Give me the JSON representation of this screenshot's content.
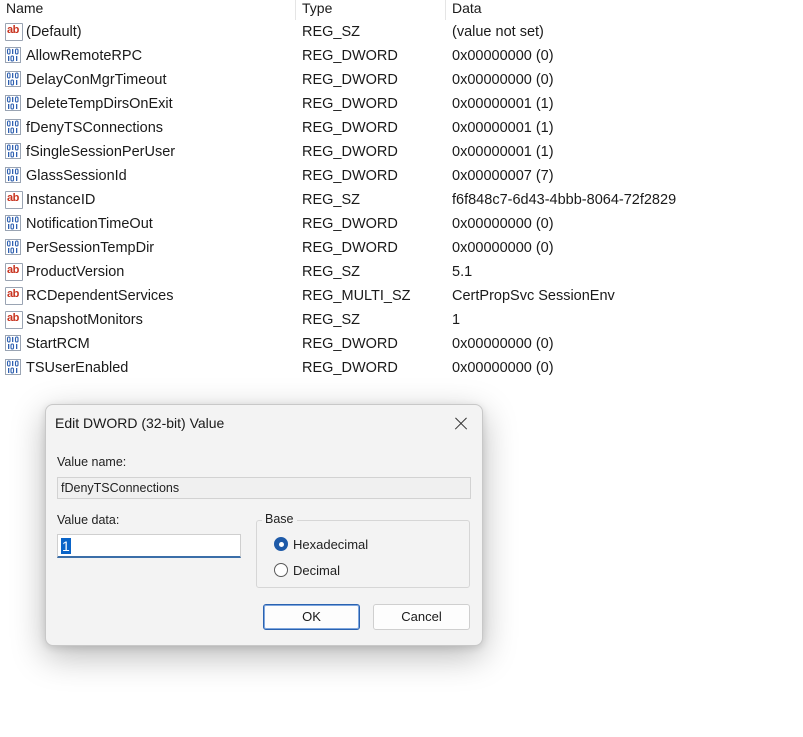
{
  "columns": {
    "name": "Name",
    "type": "Type",
    "data": "Data"
  },
  "rows": [
    {
      "icon": "string-value-icon",
      "name": "(Default)",
      "type": "REG_SZ",
      "data": "(value not set)"
    },
    {
      "icon": "binary-value-icon",
      "name": "AllowRemoteRPC",
      "type": "REG_DWORD",
      "data": "0x00000000 (0)"
    },
    {
      "icon": "binary-value-icon",
      "name": "DelayConMgrTimeout",
      "type": "REG_DWORD",
      "data": "0x00000000 (0)"
    },
    {
      "icon": "binary-value-icon",
      "name": "DeleteTempDirsOnExit",
      "type": "REG_DWORD",
      "data": "0x00000001 (1)"
    },
    {
      "icon": "binary-value-icon",
      "name": "fDenyTSConnections",
      "type": "REG_DWORD",
      "data": "0x00000001 (1)"
    },
    {
      "icon": "binary-value-icon",
      "name": "fSingleSessionPerUser",
      "type": "REG_DWORD",
      "data": "0x00000001 (1)"
    },
    {
      "icon": "binary-value-icon",
      "name": "GlassSessionId",
      "type": "REG_DWORD",
      "data": "0x00000007 (7)"
    },
    {
      "icon": "string-value-icon",
      "name": "InstanceID",
      "type": "REG_SZ",
      "data": "f6f848c7-6d43-4bbb-8064-72f2829"
    },
    {
      "icon": "binary-value-icon",
      "name": "NotificationTimeOut",
      "type": "REG_DWORD",
      "data": "0x00000000 (0)"
    },
    {
      "icon": "binary-value-icon",
      "name": "PerSessionTempDir",
      "type": "REG_DWORD",
      "data": "0x00000000 (0)"
    },
    {
      "icon": "string-value-icon",
      "name": "ProductVersion",
      "type": "REG_SZ",
      "data": "5.1"
    },
    {
      "icon": "string-value-icon",
      "name": "RCDependentServices",
      "type": "REG_MULTI_SZ",
      "data": "CertPropSvc SessionEnv"
    },
    {
      "icon": "string-value-icon",
      "name": "SnapshotMonitors",
      "type": "REG_SZ",
      "data": "1"
    },
    {
      "icon": "binary-value-icon",
      "name": "StartRCM",
      "type": "REG_DWORD",
      "data": "0x00000000 (0)"
    },
    {
      "icon": "binary-value-icon",
      "name": "TSUserEnabled",
      "type": "REG_DWORD",
      "data": "0x00000000 (0)"
    }
  ],
  "dialog": {
    "title": "Edit DWORD (32-bit) Value",
    "value_name_label": "Value name:",
    "value_name": "fDenyTSConnections",
    "value_data_label": "Value data:",
    "value_data": "1",
    "base_label": "Base",
    "base_options": [
      {
        "label": "Hexadecimal",
        "selected": true
      },
      {
        "label": "Decimal",
        "selected": false
      }
    ],
    "ok_label": "OK",
    "cancel_label": "Cancel"
  },
  "colors": {
    "accent": "#1e5aa8",
    "selection": "#0a64c8",
    "string_icon_text": "#c8331f"
  }
}
